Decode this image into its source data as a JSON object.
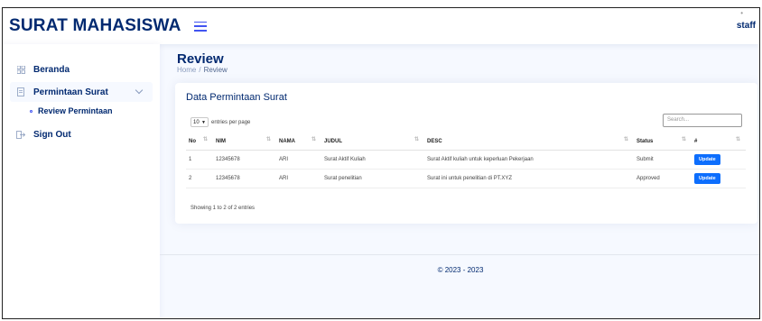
{
  "header": {
    "brand": "SURAT MAHASISWA",
    "user": "staff"
  },
  "sidebar": {
    "items": [
      {
        "label": "Beranda",
        "icon": "grid-icon"
      },
      {
        "label": "Permintaan Surat",
        "icon": "document-icon"
      },
      {
        "label": "Review Permintaan",
        "icon": "circle-icon"
      },
      {
        "label": "Sign Out",
        "icon": "sign-out-icon"
      }
    ]
  },
  "page": {
    "title": "Review",
    "breadcrumb": [
      "Home",
      "Review"
    ]
  },
  "card": {
    "title": "Data Permintaan Surat",
    "entries_value": "10",
    "entries_label": "entries per page",
    "search_placeholder": "Search...",
    "columns": [
      "No",
      "NIM",
      "NAMA",
      "JUDUL",
      "DESC",
      "Status",
      "#"
    ],
    "rows": [
      [
        "1",
        "12345678",
        "ARI",
        "Surat Aktif Kuliah",
        "Surat Aktif kuliah untuk keperluan Pekerjaan",
        "Submit",
        "Update"
      ],
      [
        "2",
        "12345678",
        "ARI",
        "Surat penelitian",
        "Surat ini untuk penelitian di PT.XYZ",
        "Approved",
        "Update"
      ]
    ],
    "showing": "Showing 1 to 2 of 2 entries"
  },
  "footer": {
    "text": "© 2023 - 2023"
  },
  "colors": {
    "primary": "#012970",
    "accent": "#4154f1",
    "button": "#0d6efd",
    "background": "#f6f9ff"
  }
}
